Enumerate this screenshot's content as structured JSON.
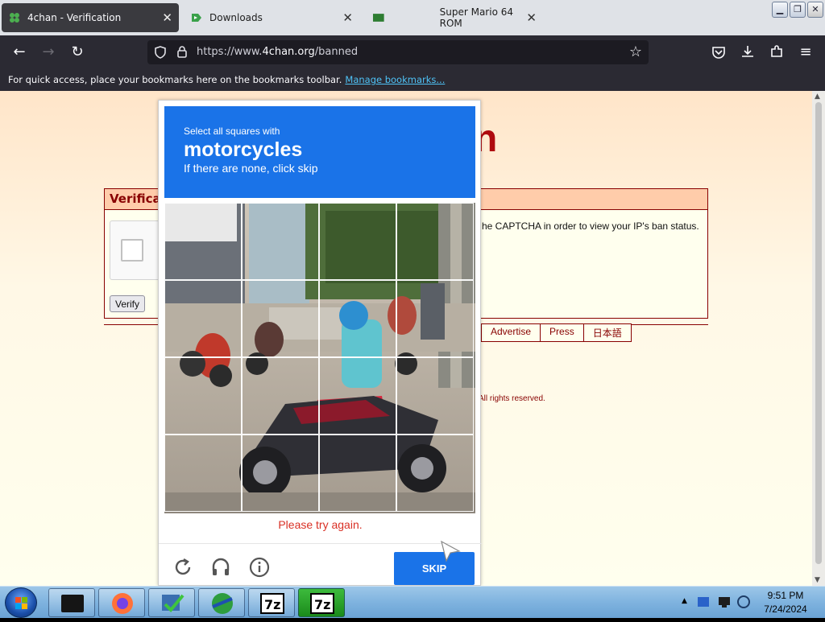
{
  "browser": {
    "tabs": [
      {
        "title": "4chan - Verification",
        "active": true
      },
      {
        "title": "Downloads",
        "active": false
      },
      {
        "title": "Super Mario 64 ROM",
        "active": false
      }
    ],
    "url_prefix": "https://www.",
    "url_host": "4chan.org",
    "url_path": "/banned",
    "bookmarks_message": "For quick access, place your bookmarks here on the bookmarks toolbar.",
    "bookmarks_link": "Manage bookmarks..."
  },
  "page": {
    "heading_fragment": "n",
    "verify_title": "Verifica",
    "verify_message": "he CAPTCHA in order to view your IP's ban status.",
    "verify_button": "Verify",
    "footer_links": [
      "Advertise",
      "Press",
      "日本語"
    ],
    "copyright": "All rights reserved."
  },
  "captcha": {
    "instruction_line1": "Select all squares with",
    "keyword": "motorcycles",
    "instruction_line2": "If there are none, click skip",
    "error_message": "Please try again.",
    "skip_label": "SKIP",
    "icons": [
      "reload-icon",
      "audio-icon",
      "info-icon"
    ],
    "accent_color": "#1a73e8",
    "error_color": "#d93025"
  },
  "taskbar": {
    "clock_time": "9:51 PM",
    "clock_date": "7/24/2024"
  }
}
